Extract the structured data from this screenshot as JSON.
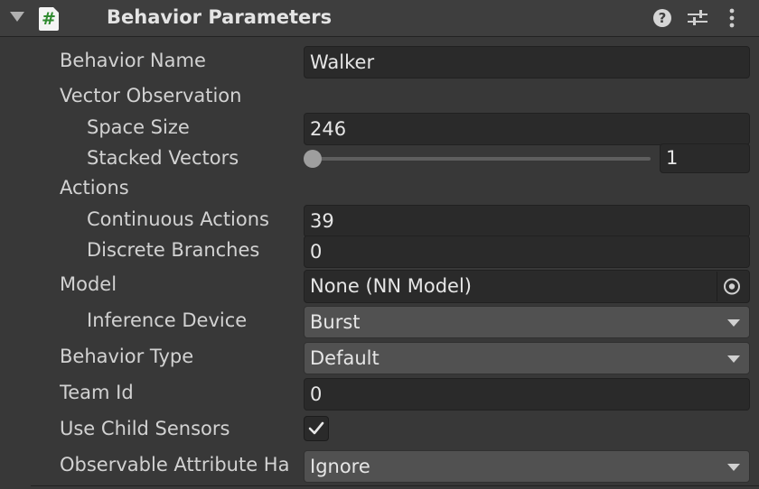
{
  "header": {
    "script_icon_glyph": "#",
    "title": "Behavior Parameters",
    "help_glyph": "?"
  },
  "fields": {
    "behavior_name": {
      "label": "Behavior Name",
      "value": "Walker"
    },
    "vector_observation": {
      "label": "Vector Observation"
    },
    "space_size": {
      "label": "Space Size",
      "value": "246"
    },
    "stacked_vectors": {
      "label": "Stacked Vectors",
      "value": "1",
      "slider_fraction": 0.0
    },
    "actions": {
      "label": "Actions"
    },
    "continuous_actions": {
      "label": "Continuous Actions",
      "value": "39"
    },
    "discrete_branches": {
      "label": "Discrete Branches",
      "value": "0"
    },
    "model": {
      "label": "Model",
      "value": "None (NN Model)"
    },
    "inference_device": {
      "label": "Inference Device",
      "value": "Burst"
    },
    "behavior_type": {
      "label": "Behavior Type",
      "value": "Default"
    },
    "team_id": {
      "label": "Team Id",
      "value": "0"
    },
    "use_child_sensors": {
      "label": "Use Child Sensors",
      "checked": true
    },
    "observable_attribute": {
      "label": "Observable Attribute Ha",
      "value": "Ignore"
    }
  },
  "colors": {
    "background": "#383838",
    "header": "#3e3e3e",
    "field": "#2a2a2a",
    "dropdown": "#515151",
    "script_icon_hash": "#2f8a2f"
  },
  "icons": [
    "foldout-arrow-icon",
    "script-icon",
    "help-icon",
    "presets-icon",
    "more-menu-icon",
    "object-picker-icon",
    "checkmark-icon",
    "dropdown-arrow-icon"
  ]
}
